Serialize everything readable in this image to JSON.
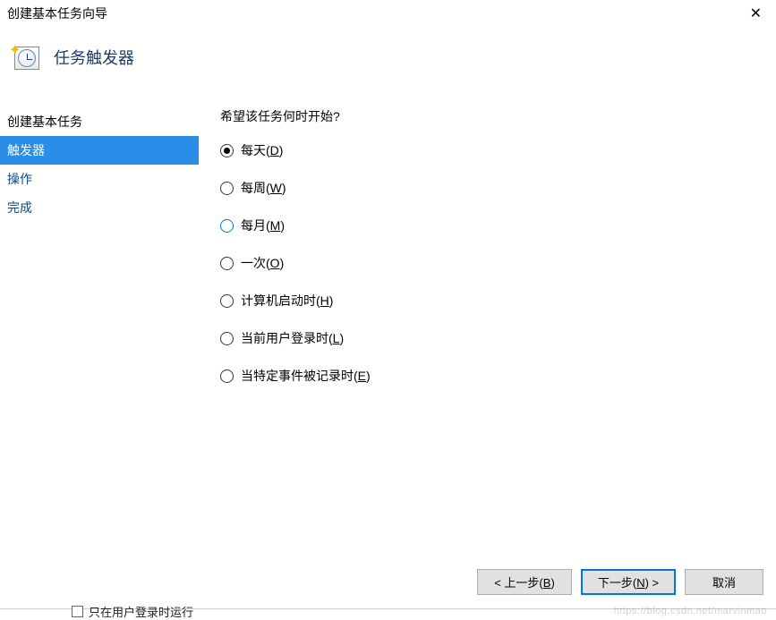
{
  "window": {
    "title": "创建基本任务向导",
    "close": "✕"
  },
  "header": {
    "title": "任务触发器"
  },
  "sidebar": {
    "items": [
      {
        "label": "创建基本任务",
        "active": false,
        "black": true
      },
      {
        "label": "触发器",
        "active": true,
        "black": false
      },
      {
        "label": "操作",
        "active": false,
        "black": false
      },
      {
        "label": "完成",
        "active": false,
        "black": false
      }
    ]
  },
  "content": {
    "question": "希望该任务何时开始?",
    "options": [
      {
        "pre": "每天(",
        "u": "D",
        "post": ")",
        "selected": true,
        "hover": false
      },
      {
        "pre": "每周(",
        "u": "W",
        "post": ")",
        "selected": false,
        "hover": false
      },
      {
        "pre": "每月(",
        "u": "M",
        "post": ")",
        "selected": false,
        "hover": true
      },
      {
        "pre": "一次(",
        "u": "O",
        "post": ")",
        "selected": false,
        "hover": false
      },
      {
        "pre": "计算机启动时(",
        "u": "H",
        "post": ")",
        "selected": false,
        "hover": false
      },
      {
        "pre": "当前用户登录时(",
        "u": "L",
        "post": ")",
        "selected": false,
        "hover": false
      },
      {
        "pre": "当特定事件被记录时(",
        "u": "E",
        "post": ")",
        "selected": false,
        "hover": false
      }
    ]
  },
  "footer": {
    "back_pre": "< 上一步(",
    "back_u": "B",
    "back_post": ")",
    "next_pre": "下一步(",
    "next_u": "N",
    "next_post": ") >",
    "cancel": "取消"
  },
  "watermark": "https://blog.csdn.net/marvinmao",
  "partial": "只在用户登录时运行"
}
